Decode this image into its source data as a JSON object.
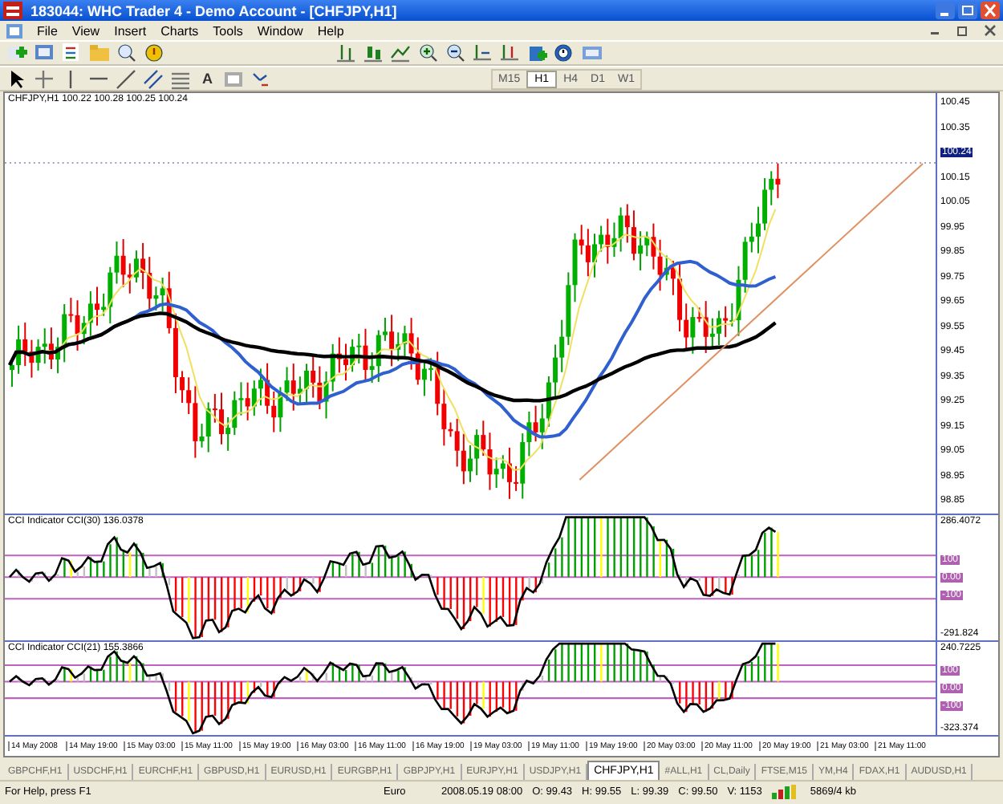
{
  "window": {
    "title": "183044: WHC Trader 4 - Demo Account - [CHFJPY,H1]"
  },
  "menu": [
    "File",
    "View",
    "Insert",
    "Charts",
    "Tools",
    "Window",
    "Help"
  ],
  "drawing_toolbar": {
    "text_tool": "A"
  },
  "timeframes": [
    {
      "label": "M15",
      "selected": false
    },
    {
      "label": "H1",
      "selected": true
    },
    {
      "label": "H4",
      "selected": false
    },
    {
      "label": "D1",
      "selected": false
    },
    {
      "label": "W1",
      "selected": false
    }
  ],
  "chart": {
    "header": "CHFJPY,H1  100.22 100.28 100.25 100.24",
    "price_axis": [
      {
        "label": "100.45",
        "current": false
      },
      {
        "label": "100.35",
        "current": false
      },
      {
        "label": "100.24",
        "current": true
      },
      {
        "label": "100.15",
        "current": false
      },
      {
        "label": "100.05",
        "current": false
      },
      {
        "label": "99.95",
        "current": false
      },
      {
        "label": "99.85",
        "current": false
      },
      {
        "label": "99.75",
        "current": false
      },
      {
        "label": "99.65",
        "current": false
      },
      {
        "label": "99.55",
        "current": false
      },
      {
        "label": "99.45",
        "current": false
      },
      {
        "label": "99.35",
        "current": false
      },
      {
        "label": "99.25",
        "current": false
      },
      {
        "label": "99.15",
        "current": false
      },
      {
        "label": "99.05",
        "current": false
      },
      {
        "label": "98.95",
        "current": false
      },
      {
        "label": "98.85",
        "current": false
      }
    ]
  },
  "indicators": [
    {
      "title": "CCI Indicator  CCI(30) 136.0378",
      "axis_max": "286.4072",
      "levels": [
        "100",
        "0.00",
        "-100"
      ],
      "axis_min": "-291.824"
    },
    {
      "title": "CCI Indicator  CCI(21) 155.3866",
      "axis_max": "240.7225",
      "levels": [
        "100",
        "0.00",
        "-100"
      ],
      "axis_min": "-323.374"
    }
  ],
  "time_axis": [
    "14 May 2008",
    "14 May 19:00",
    "15 May 03:00",
    "15 May 11:00",
    "15 May 19:00",
    "16 May 03:00",
    "16 May 11:00",
    "16 May 19:00",
    "19 May 03:00",
    "19 May 11:00",
    "19 May 19:00",
    "20 May 03:00",
    "20 May 11:00",
    "20 May 19:00",
    "21 May 03:00",
    "21 May 11:00"
  ],
  "tabs": [
    {
      "label": "GBPCHF,H1",
      "selected": false
    },
    {
      "label": "USDCHF,H1",
      "selected": false
    },
    {
      "label": "EURCHF,H1",
      "selected": false
    },
    {
      "label": "GBPUSD,H1",
      "selected": false
    },
    {
      "label": "EURUSD,H1",
      "selected": false
    },
    {
      "label": "EURGBP,H1",
      "selected": false
    },
    {
      "label": "GBPJPY,H1",
      "selected": false
    },
    {
      "label": "EURJPY,H1",
      "selected": false
    },
    {
      "label": "USDJPY,H1",
      "selected": false
    },
    {
      "label": "CHFJPY,H1",
      "selected": true
    },
    {
      "label": "#ALL,H1",
      "selected": false
    },
    {
      "label": "CL,Daily",
      "selected": false
    },
    {
      "label": "FTSE,M15",
      "selected": false
    },
    {
      "label": "YM,H4",
      "selected": false
    },
    {
      "label": "FDAX,H1",
      "selected": false
    },
    {
      "label": "AUDUSD,H1",
      "selected": false
    }
  ],
  "status_bar": {
    "help": "For Help, press F1",
    "profile": "Euro",
    "fields": [
      "2008.05.19 08:00",
      "O: 99.43",
      "H: 99.55",
      "L: 99.39",
      "C: 99.50",
      "V: 1153"
    ],
    "traffic": "5869/4 kb"
  }
}
